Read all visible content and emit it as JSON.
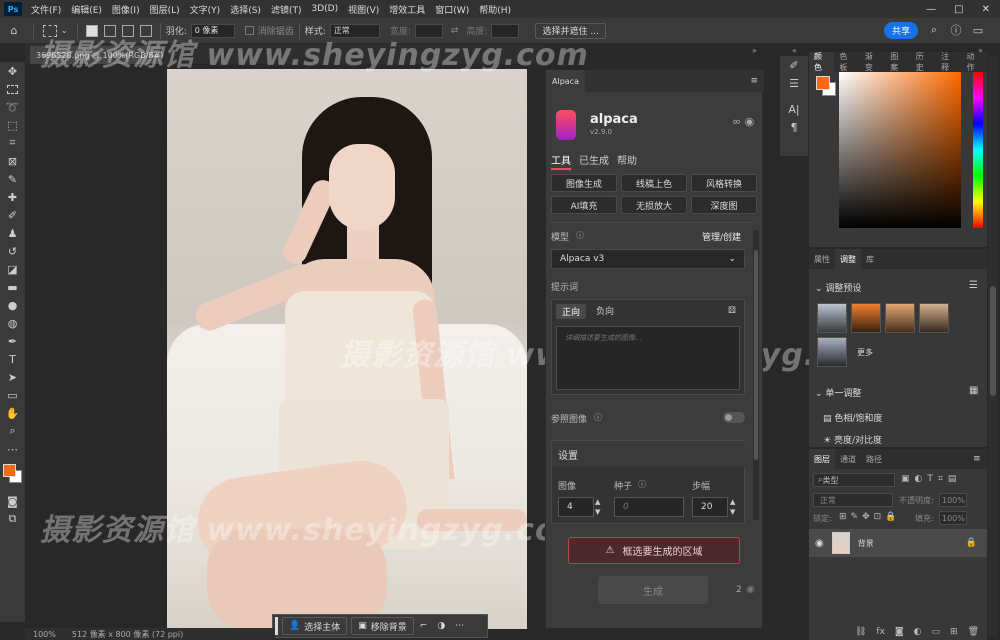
{
  "menu": {
    "logo": "Ps",
    "items": [
      "文件(F)",
      "编辑(E)",
      "图像(I)",
      "图层(L)",
      "文字(Y)",
      "选择(S)",
      "滤镜(T)",
      "3D(D)",
      "视图(V)",
      "增效工具",
      "窗口(W)",
      "帮助(H)"
    ],
    "window_controls": [
      "—",
      "□",
      "✕"
    ]
  },
  "options": {
    "feather_label": "羽化:",
    "feather_value": "0 像素",
    "antialias_label": "消除锯齿",
    "style_label": "样式:",
    "style_value": "正常",
    "width_label": "宽度:",
    "height_label": "高度:",
    "select_mask_button": "选择并遮住 ...",
    "share_button": "共享"
  },
  "document": {
    "tab_title": "3696528.png @ 100%(RGB/8#)",
    "status_zoom": "100%",
    "status_size": "512 像素 x 800 像素 (72 ppi)"
  },
  "context_bar": {
    "select_subject": "选择主体",
    "remove_background": "移除背景"
  },
  "alpaca": {
    "panel_tab": "Alpaca",
    "title": "alpaca",
    "version": "v2.9.0",
    "nav": [
      "工具",
      "已生成",
      "帮助"
    ],
    "tools": [
      "图像生成",
      "线稿上色",
      "风格转换",
      "AI填充",
      "无损放大",
      "深度图"
    ],
    "model_label": "模型",
    "manage_label": "管理/创建",
    "model_value": "Alpaca v3",
    "prompt_label": "提示词",
    "prompt_tabs": [
      "正向",
      "负向"
    ],
    "prompt_placeholder": "详细描述要生成的图像...",
    "reference_label": "参照图像",
    "settings_label": "设置",
    "images_label": "图像",
    "seed_label": "种子",
    "steps_label": "步幅",
    "images_value": "4",
    "seed_placeholder": "0",
    "steps_value": "20",
    "warning_text": "框选要生成的区域",
    "generate_button": "生成",
    "generate_count": "2"
  },
  "color_panel": {
    "tabs": [
      "颜色",
      "色板",
      "渐变",
      "图案",
      "历史",
      "注释",
      "动作"
    ],
    "fg_color": "#f26b11",
    "bg_color": "#ffffff"
  },
  "adjust_panel": {
    "tabs": [
      "属性",
      "调整",
      "库"
    ],
    "presets_label": "调整预设",
    "more_label": "更多",
    "single_label": "单一调整",
    "items": [
      "色相/饱和度",
      "亮度/对比度"
    ]
  },
  "layers_panel": {
    "tabs": [
      "图层",
      "通道",
      "路径"
    ],
    "filter_kind": "类型",
    "blend_mode": "正常",
    "opacity_label": "不透明度:",
    "opacity_value": "100%",
    "lock_label": "锁定:",
    "fill_label": "填充:",
    "fill_value": "100%",
    "layer_name": "背景"
  },
  "watermark": "摄影资源馆 www.sheyingzyg.com"
}
